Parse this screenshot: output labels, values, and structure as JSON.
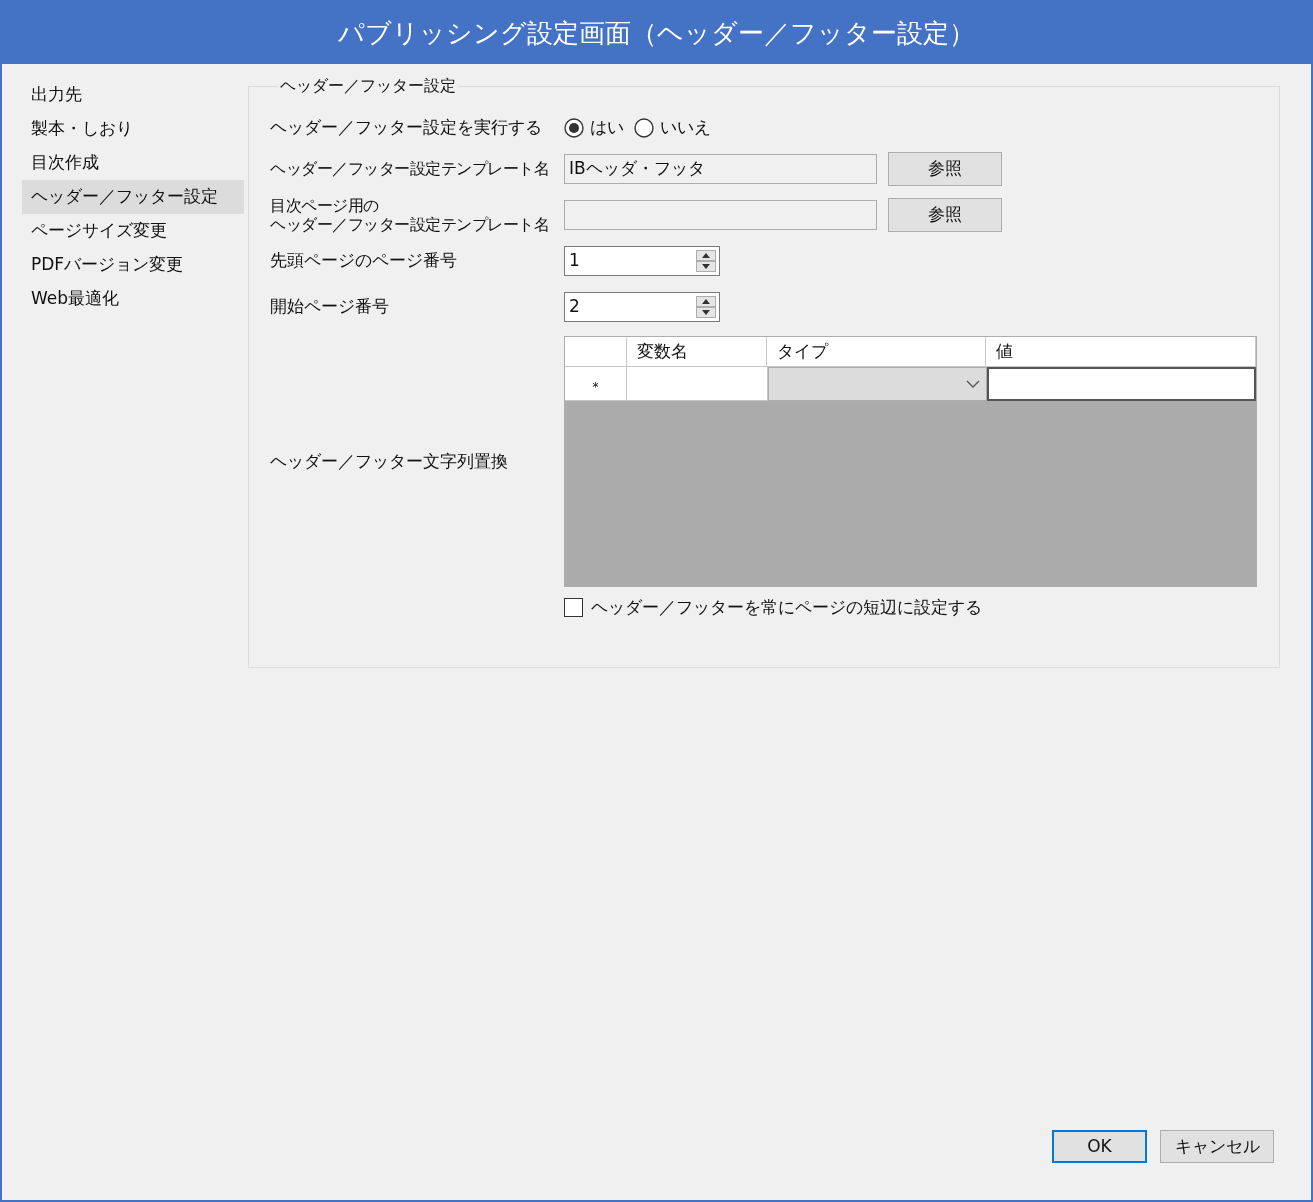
{
  "window": {
    "title": "パブリッシング設定画面（ヘッダー／フッター設定）"
  },
  "sidebar": {
    "items": [
      {
        "label": "出力先",
        "selected": false
      },
      {
        "label": "製本・しおり",
        "selected": false
      },
      {
        "label": "目次作成",
        "selected": false
      },
      {
        "label": "ヘッダー／フッター設定",
        "selected": true
      },
      {
        "label": "ページサイズ変更",
        "selected": false
      },
      {
        "label": "PDFバージョン変更",
        "selected": false
      },
      {
        "label": "Web最適化",
        "selected": false
      }
    ]
  },
  "group": {
    "title": "ヘッダー／フッター設定",
    "execute": {
      "label": "ヘッダー／フッター設定を実行する",
      "options": [
        {
          "label": "はい",
          "selected": true
        },
        {
          "label": "いいえ",
          "selected": false
        }
      ]
    },
    "template": {
      "label": "ヘッダー／フッター設定テンプレート名",
      "value": "IBヘッダ・フッタ",
      "button": "参照"
    },
    "toc_template": {
      "label_lines": [
        "目次ページ用の",
        "ヘッダー／フッター設定テンプレート名"
      ],
      "button": "参照"
    },
    "first_page_number": {
      "label": "先頭ページのページ番号",
      "value": "1"
    },
    "start_page_number": {
      "label": "開始ページ番号",
      "value": "2"
    },
    "replace": {
      "label": "ヘッダー／フッター文字列置換",
      "columns": [
        "変数名",
        "タイプ",
        "値"
      ],
      "new_row_marker": "*"
    },
    "short_edge": {
      "label": "ヘッダー／フッターを常にページの短辺に設定する",
      "checked": false
    }
  },
  "buttons": [
    {
      "label": "OK",
      "default": true
    },
    {
      "label": "キャンセル",
      "default": false
    }
  ]
}
